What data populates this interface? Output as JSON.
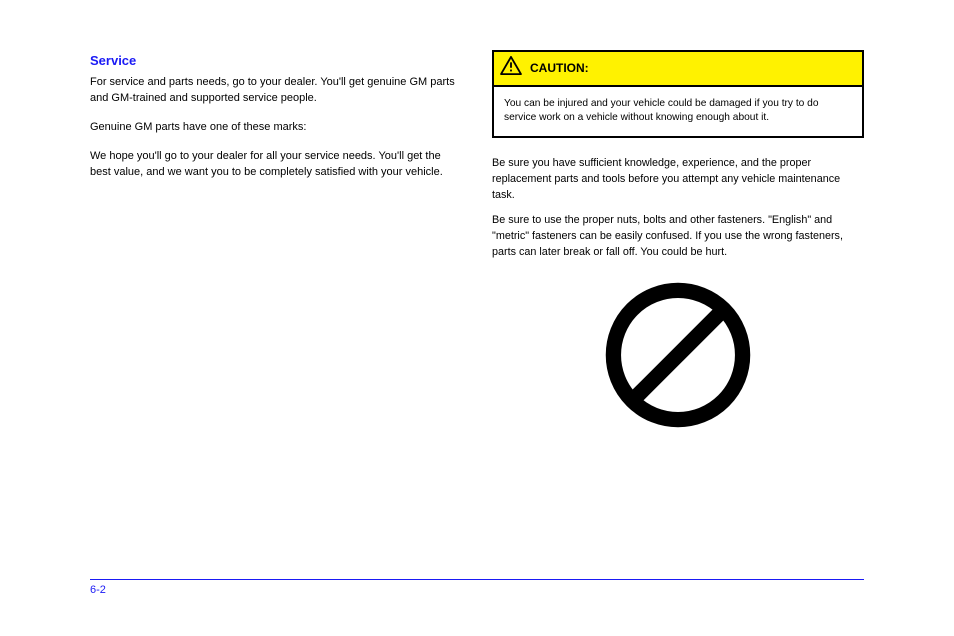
{
  "left": {
    "heading": "Service",
    "p1": "For service and parts needs, go to your dealer. You'll get genuine GM parts and GM-trained and supported service people.",
    "p2": "Genuine GM parts have one of these marks:",
    "p3": "We hope you'll go to your dealer for all your service needs. You'll get the best value, and we want you to be completely satisfied with your vehicle."
  },
  "right": {
    "caution_label": "CAUTION:",
    "caution_body": "You can be injured and your vehicle could be damaged if you try to do service work on a vehicle without knowing enough about it.",
    "para1": "Be sure you have sufficient knowledge, experience, and the proper replacement parts and tools before you attempt any vehicle maintenance task.",
    "para2": "Be sure to use the proper nuts, bolts and other fasteners. \"English\" and \"metric\" fasteners can be easily confused. If you use the wrong fasteners, parts can later break or fall off. You could be hurt."
  },
  "footer": {
    "page": "6-2"
  }
}
